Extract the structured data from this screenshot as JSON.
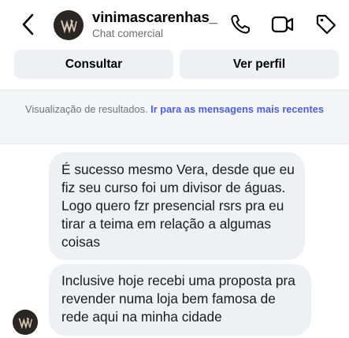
{
  "header": {
    "back_icon": "chevron-left-icon",
    "username": "vinimascarenhas_",
    "subtitle": "Chat comercial",
    "icons": [
      "phone-icon",
      "video-icon",
      "tag-icon"
    ]
  },
  "actions": {
    "consultar_label": "Consultar",
    "ver_perfil_label": "Ver perfil"
  },
  "notice": {
    "text": "Visualização de resultados. ",
    "link": "Ir para as mensagens mais recentes"
  },
  "messages": [
    {
      "text": "É sucesso mesmo Vera, desde que eu fiz seu curso foi um divisor de águas. Logo quero fzr presencial rsrs pra eu tirar a teima em relação a algumas coisas"
    },
    {
      "text": "Inclusive hoje recebi uma proposta pra revender numa loja bem famosa de rede aqui na minha cidade"
    }
  ],
  "colors": {
    "bubble_bg": "#eff0f3",
    "link": "#4a5df3",
    "muted_text": "#737373"
  }
}
